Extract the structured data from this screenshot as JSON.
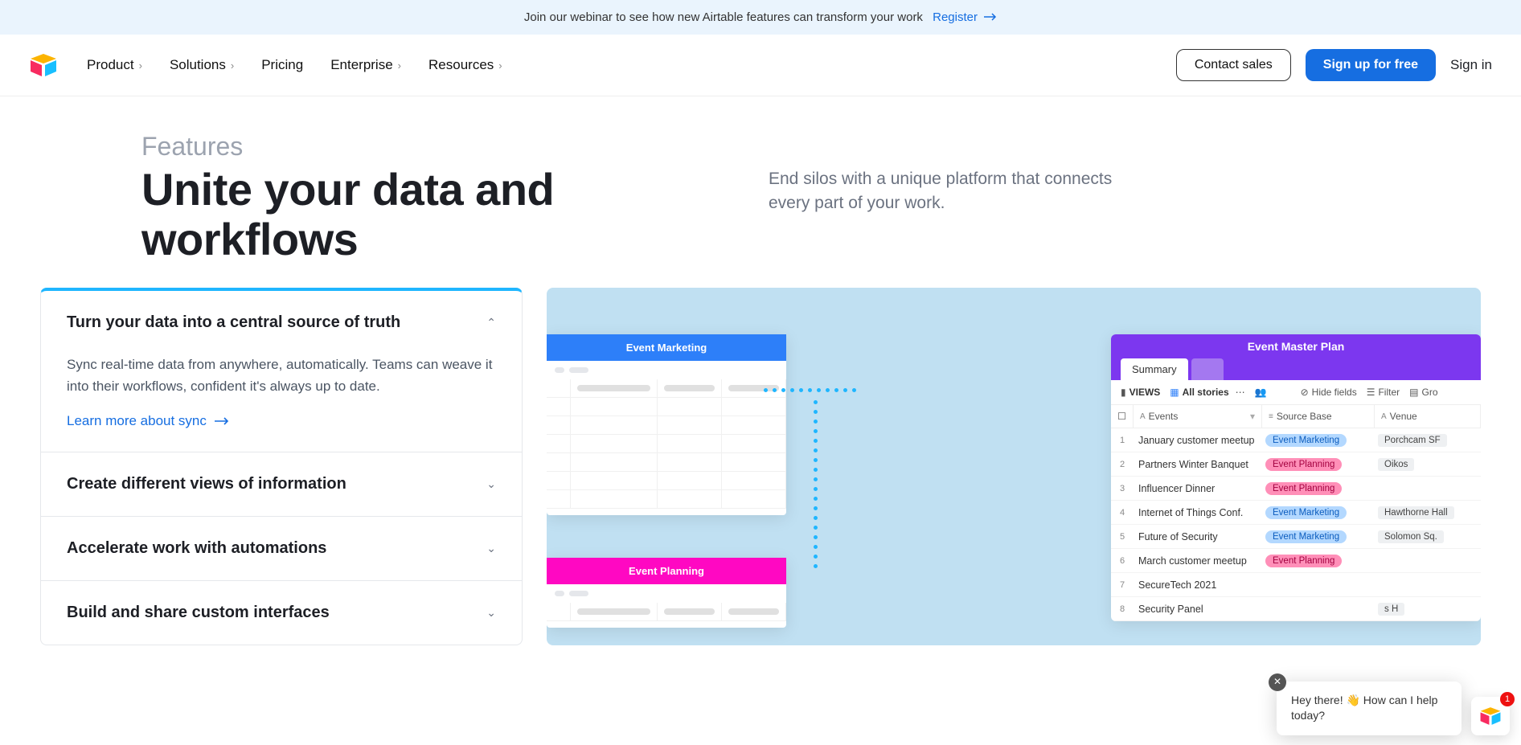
{
  "banner": {
    "text": "Join our webinar to see how new Airtable features can transform your work",
    "link": "Register"
  },
  "nav": {
    "items": [
      "Product",
      "Solutions",
      "Pricing",
      "Enterprise",
      "Resources"
    ],
    "contact": "Contact sales",
    "signup": "Sign up for free",
    "signin": "Sign in"
  },
  "hero": {
    "eyebrow": "Features",
    "title": "Unite your data and workflows",
    "desc": "End silos with a unique platform that connects every part of your work."
  },
  "accordion": [
    {
      "title": "Turn your data into a central source of truth",
      "desc": "Sync real-time data from anywhere, automatically. Teams can weave it into their workflows, confident it's always up to date.",
      "link": "Learn more about sync",
      "open": true
    },
    {
      "title": "Create different views of information",
      "open": false
    },
    {
      "title": "Accelerate work with automations",
      "open": false
    },
    {
      "title": "Build and share custom interfaces",
      "open": false
    }
  ],
  "preview": {
    "card1_title": "Event Marketing",
    "card2_title": "Event Planning",
    "big_title": "Event Master Plan",
    "big_tab": "Summary",
    "toolbar": {
      "views": "VIEWS",
      "allstories": "All stories",
      "hide": "Hide fields",
      "filter": "Filter",
      "group": "Gro"
    },
    "columns": {
      "events": "Events",
      "source": "Source Base",
      "venue": "Venue"
    },
    "rows": [
      {
        "n": "1",
        "ev": "January customer meetup",
        "src": "Event Marketing",
        "srcType": "blue",
        "vn": "Porchcam SF"
      },
      {
        "n": "2",
        "ev": "Partners Winter Banquet",
        "src": "Event Planning",
        "srcType": "pink",
        "vn": "Oikos"
      },
      {
        "n": "3",
        "ev": "Influencer Dinner",
        "src": "Event Planning",
        "srcType": "pink",
        "vn": ""
      },
      {
        "n": "4",
        "ev": "Internet of Things Conf.",
        "src": "Event Marketing",
        "srcType": "blue",
        "vn": "Hawthorne Hall"
      },
      {
        "n": "5",
        "ev": "Future of Security",
        "src": "Event Marketing",
        "srcType": "blue",
        "vn": "Solomon Sq."
      },
      {
        "n": "6",
        "ev": "March customer meetup",
        "src": "Event Planning",
        "srcType": "pink",
        "vn": ""
      },
      {
        "n": "7",
        "ev": "SecureTech 2021",
        "src": "",
        "srcType": "",
        "vn": ""
      },
      {
        "n": "8",
        "ev": "Security Panel",
        "src": "",
        "srcType": "",
        "vn": "s H"
      }
    ]
  },
  "chat": {
    "text_before": "Hey there! ",
    "text_after": " How can I help today?",
    "badge": "1"
  }
}
